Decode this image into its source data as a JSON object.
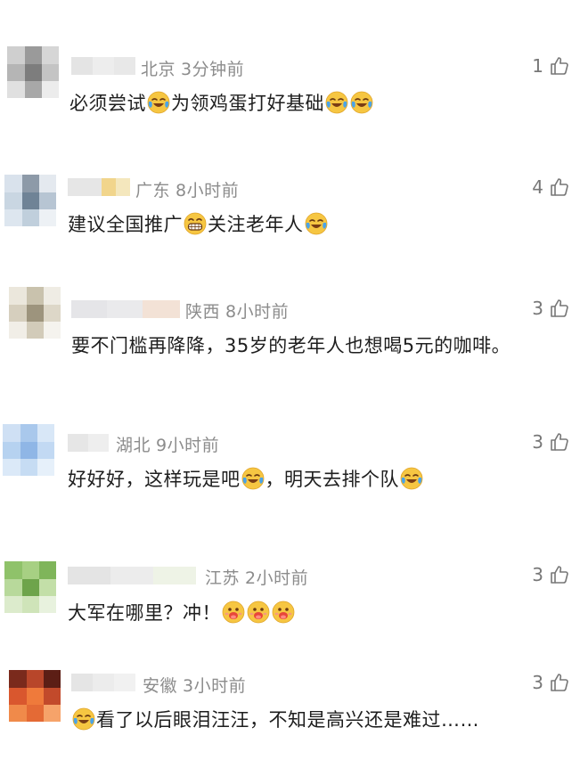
{
  "comments": [
    {
      "location": "北京",
      "time": "3分钟前",
      "likes": "1",
      "body": [
        {
          "t": "必须尝试"
        },
        {
          "e": "cry-laugh"
        },
        {
          "t": "为领鸡蛋打好基础"
        },
        {
          "e": "cry-laugh"
        },
        {
          "e": "cry-laugh"
        }
      ]
    },
    {
      "location": "广东",
      "time": "8小时前",
      "likes": "4",
      "body": [
        {
          "t": "建议全国推广"
        },
        {
          "e": "grin"
        },
        {
          "t": "关注老年人"
        },
        {
          "e": "cry-laugh"
        }
      ]
    },
    {
      "location": "陕西",
      "time": "8小时前",
      "likes": "3",
      "body": [
        {
          "t": "要不门槛再降降，35岁的老年人也想喝5元的咖啡。"
        }
      ]
    },
    {
      "location": "湖北",
      "time": "9小时前",
      "likes": "3",
      "body": [
        {
          "t": "好好好，这样玩是吧"
        },
        {
          "e": "cry-laugh"
        },
        {
          "t": "，明天去排个队"
        },
        {
          "e": "cry-laugh"
        }
      ]
    },
    {
      "location": "江苏",
      "time": "2小时前",
      "likes": "3",
      "body": [
        {
          "t": "大军在哪里？冲！"
        },
        {
          "e": "drool"
        },
        {
          "e": "drool"
        },
        {
          "e": "drool"
        }
      ]
    },
    {
      "location": "安徽",
      "time": "3小时前",
      "likes": "3",
      "body": [
        {
          "e": "cry-laugh"
        },
        {
          "t": "看了以后眼泪汪汪，不知是高兴还是难过……"
        }
      ]
    }
  ],
  "icons": {
    "like": "thumbs-up-icon"
  },
  "colors": {
    "meta": "#8c8c8c",
    "text": "#1e1e1e",
    "emoji_face": "#f6c642"
  }
}
